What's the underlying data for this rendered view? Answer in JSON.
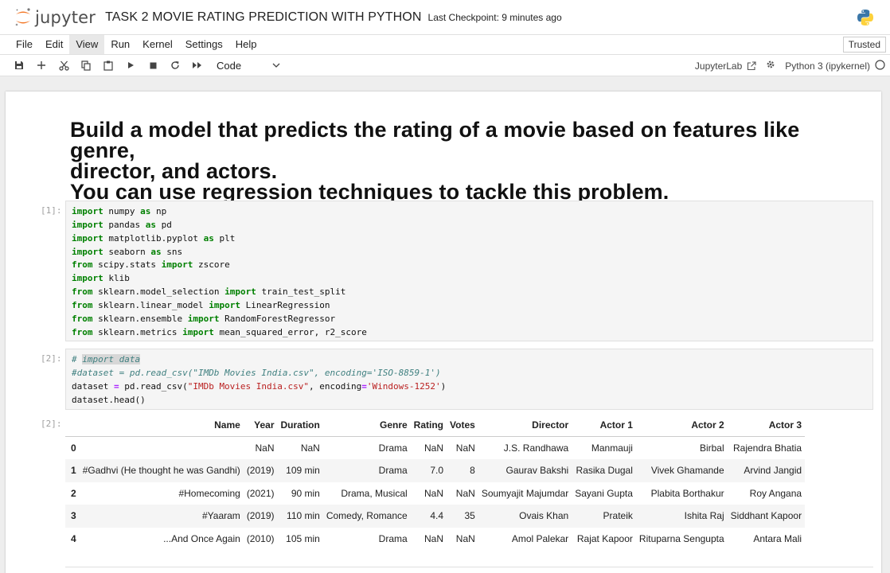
{
  "header": {
    "logo_text": "jupyter",
    "notebook_title": "TASK 2 MOVIE RATING PREDICTION WITH PYTHON",
    "checkpoint": "Last Checkpoint: 9 minutes ago",
    "logo_color": "#f37726"
  },
  "menu": {
    "items": [
      "File",
      "Edit",
      "View",
      "Run",
      "Kernel",
      "Settings",
      "Help"
    ],
    "active": "View",
    "trusted": "Trusted"
  },
  "toolbar": {
    "cell_type": "Code",
    "jupyterlab_label": "JupyterLab",
    "kernel_label": "Python 3 (ipykernel)"
  },
  "markdown": {
    "line1": "Build a model that predicts the rating of a movie based on features like genre,",
    "line2": "director, and actors.",
    "line3": "You can use regression techniques to tackle this problem."
  },
  "cells": {
    "cell1_prompt": "[1]:",
    "cell2_prompt": "[2]:",
    "out2_prompt": "[2]:"
  },
  "table": {
    "columns": [
      "",
      "Name",
      "Year",
      "Duration",
      "Genre",
      "Rating",
      "Votes",
      "Director",
      "Actor 1",
      "Actor 2",
      "Actor 3"
    ],
    "rows": [
      [
        "0",
        "",
        "NaN",
        "NaN",
        "Drama",
        "NaN",
        "NaN",
        "J.S. Randhawa",
        "Manmauji",
        "Birbal",
        "Rajendra Bhatia"
      ],
      [
        "1",
        "#Gadhvi (He thought he was Gandhi)",
        "(2019)",
        "109 min",
        "Drama",
        "7.0",
        "8",
        "Gaurav Bakshi",
        "Rasika Dugal",
        "Vivek Ghamande",
        "Arvind Jangid"
      ],
      [
        "2",
        "#Homecoming",
        "(2021)",
        "90 min",
        "Drama, Musical",
        "NaN",
        "NaN",
        "Soumyajit Majumdar",
        "Sayani Gupta",
        "Plabita Borthakur",
        "Roy Angana"
      ],
      [
        "3",
        "#Yaaram",
        "(2019)",
        "110 min",
        "Comedy, Romance",
        "4.4",
        "35",
        "Ovais Khan",
        "Prateik",
        "Ishita Raj",
        "Siddhant Kapoor"
      ],
      [
        "4",
        "...And Once Again",
        "(2010)",
        "105 min",
        "Drama",
        "NaN",
        "NaN",
        "Amol Palekar",
        "Rajat Kapoor",
        "Rituparna Sengupta",
        "Antara Mali"
      ]
    ]
  }
}
